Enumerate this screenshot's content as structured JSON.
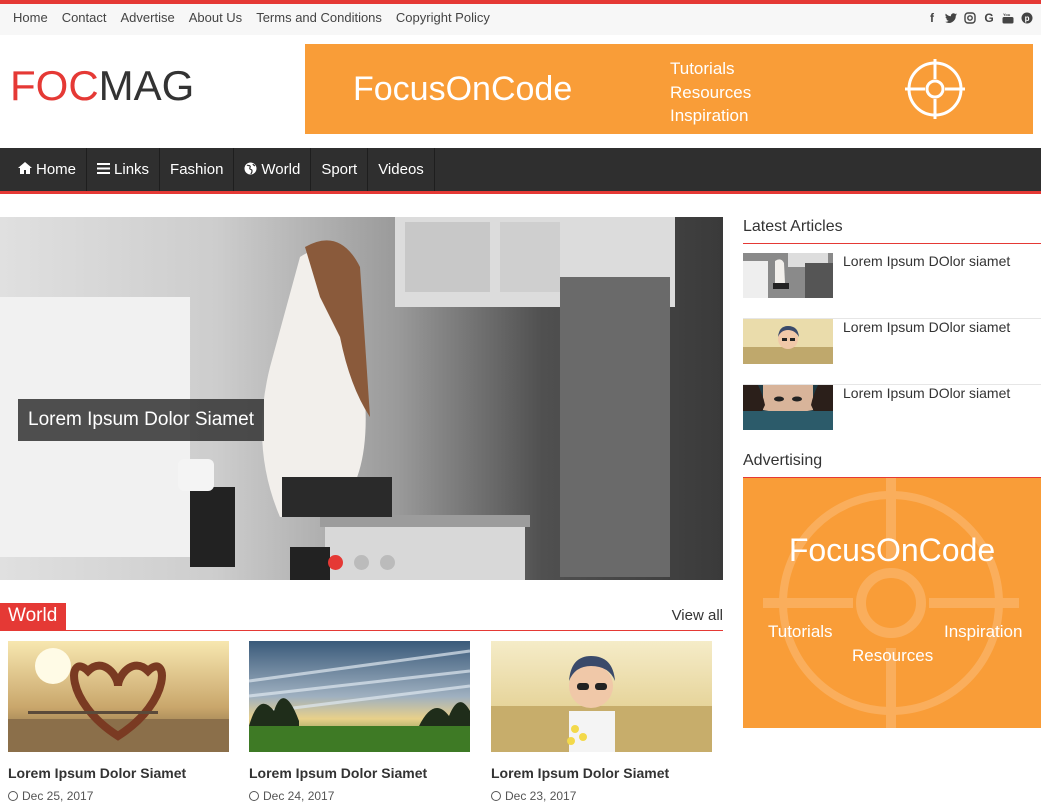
{
  "topbar": {
    "links": [
      "Home",
      "Contact",
      "Advertise",
      "About Us",
      "Terms and Conditions",
      "Copyright Policy"
    ],
    "social": [
      "facebook-icon",
      "twitter-icon",
      "instagram-icon",
      "google-icon",
      "youtube-icon",
      "pinterest-icon"
    ]
  },
  "header": {
    "logo_red": "FOC",
    "logo_dark": "MAG",
    "banner": {
      "name": "FocusOnCode",
      "line1": "Tutorials",
      "line2": "Resources",
      "line3": "Inspiration"
    }
  },
  "nav": {
    "items": [
      {
        "label": "Home",
        "icon": "home-icon"
      },
      {
        "label": "Links",
        "icon": "bars-icon"
      },
      {
        "label": "Fashion",
        "icon": ""
      },
      {
        "label": "World",
        "icon": "globe-icon"
      },
      {
        "label": "Sport",
        "icon": ""
      },
      {
        "label": "Videos",
        "icon": ""
      }
    ]
  },
  "slider": {
    "caption": "Lorem Ipsum Dolor Siamet",
    "slide_count": 3,
    "active_slide": 1
  },
  "world": {
    "label": "World",
    "view_all": "View all",
    "cards": [
      {
        "title": "Lorem Ipsum Dolor Siamet",
        "date": "Dec 25, 2017"
      },
      {
        "title": "Lorem Ipsum Dolor Siamet",
        "date": "Dec 24, 2017"
      },
      {
        "title": "Lorem Ipsum Dolor Siamet",
        "date": "Dec 23, 2017"
      }
    ]
  },
  "sidebar": {
    "latest_title": "Latest Articles",
    "latest": [
      {
        "title": "Lorem Ipsum DOlor siamet"
      },
      {
        "title": "Lorem Ipsum DOlor siamet"
      },
      {
        "title": "Lorem Ipsum DOlor siamet"
      }
    ],
    "advertising_title": "Advertising",
    "ad": {
      "name": "FocusOnCode",
      "line1": "Tutorials",
      "line2": "Resources",
      "line3": "Inspiration"
    }
  },
  "colors": {
    "accent": "#e53935",
    "nav_bg": "#2f2f2f",
    "banner": "#f99d38"
  }
}
